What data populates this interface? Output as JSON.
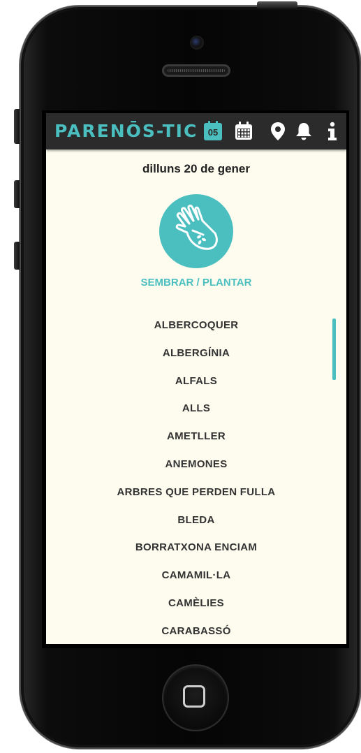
{
  "app": {
    "logo": "PARENŌS-TIC",
    "today_number": "05",
    "accent_color": "#4bbfbf",
    "toolbar_icons": [
      "calendar-today-icon",
      "calendar-month-icon",
      "location-pin-icon",
      "bell-icon",
      "info-icon"
    ]
  },
  "main": {
    "date_title": "dilluns 20 de gener",
    "action_icon": "hand-with-seeds-icon",
    "action_label": "SEMBRAR / PLANTAR",
    "items": [
      "ALBERCOQUER",
      "ALBERGÍNIA",
      "ALFALS",
      "ALLS",
      "AMETLLER",
      "ANEMONES",
      "ARBRES QUE PERDEN FULLA",
      "BLEDA",
      "BORRATXONA ENCIAM",
      "CAMAMIL·LA",
      "CAMÈLIES",
      "CARABASSÓ"
    ]
  }
}
